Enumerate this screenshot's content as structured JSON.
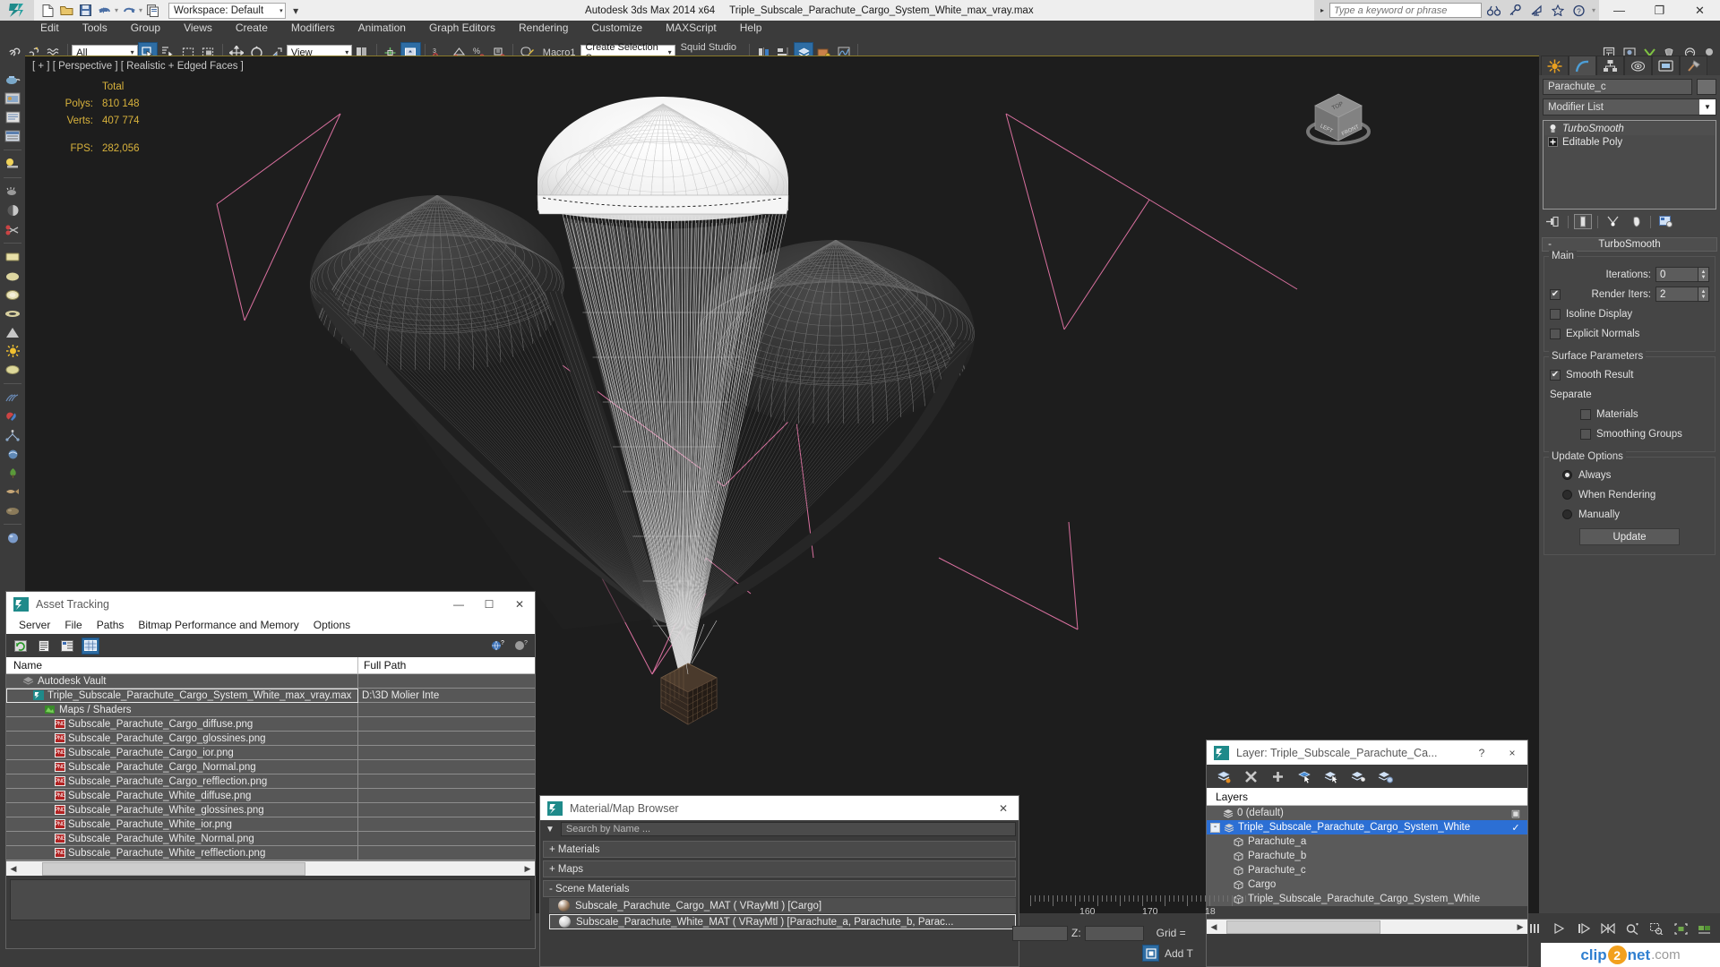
{
  "titlebar": {
    "app_title": "Autodesk 3ds Max  2014 x64",
    "file_name": "Triple_Subscale_Parachute_Cargo_System_White_max_vray.max",
    "workspace_label": "Workspace: Default",
    "search_placeholder": "Type a keyword or phrase",
    "quick_access": [
      "new-icon",
      "open-icon",
      "save-icon",
      "undo-icon",
      "redo-icon",
      "set-project-icon"
    ],
    "right_icons": [
      "binoculars-icon",
      "key-icon",
      "satellite-icon",
      "star-icon",
      "help-icon"
    ],
    "window_buttons": [
      "minimize-icon",
      "restore-icon",
      "close-icon"
    ]
  },
  "menubar": {
    "items": [
      "Edit",
      "Tools",
      "Group",
      "Views",
      "Create",
      "Modifiers",
      "Animation",
      "Graph Editors",
      "Rendering",
      "Customize",
      "MAXScript",
      "Help"
    ]
  },
  "toolbar": {
    "selection_filter": "All",
    "reference_coord": "View",
    "macro_label": "Macro1",
    "named_selection_set": "Create Selection Se",
    "squid_label": "Squid Studio v"
  },
  "viewport": {
    "label": "[ + ] [ Perspective ] [ Realistic + Edged Faces ]",
    "stats": {
      "header": "Total",
      "polys_label": "Polys:",
      "polys_value": "810 148",
      "verts_label": "Verts:",
      "verts_value": "407 774",
      "fps_label": "FPS:",
      "fps_value": "282,056"
    },
    "viewcube_faces": [
      "TOP",
      "LEFT",
      "FRONT"
    ]
  },
  "asset_tracking": {
    "title": "Asset Tracking",
    "menu": [
      "Server",
      "File",
      "Paths",
      "Bitmap Performance and Memory",
      "Options"
    ],
    "toolbar_icons": [
      "refresh-icon",
      "list-icon",
      "tree-icon",
      "grid-icon",
      "help-globe-icon",
      "help-icon"
    ],
    "columns": [
      "Name",
      "Full Path"
    ],
    "rows": [
      {
        "indent": 0,
        "icon": "vault-icon",
        "name": "Autodesk Vault",
        "path": ""
      },
      {
        "indent": 1,
        "icon": "max-icon",
        "name": "Triple_Subscale_Parachute_Cargo_System_White_max_vray.max",
        "path": "D:\\3D Molier Inte",
        "selected": true
      },
      {
        "indent": 2,
        "icon": "maps-icon",
        "name": "Maps / Shaders",
        "path": ""
      },
      {
        "indent": 3,
        "icon": "png-icon",
        "name": "Subscale_Parachute_Cargo_diffuse.png",
        "path": ""
      },
      {
        "indent": 3,
        "icon": "png-icon",
        "name": "Subscale_Parachute_Cargo_glossines.png",
        "path": ""
      },
      {
        "indent": 3,
        "icon": "png-icon",
        "name": "Subscale_Parachute_Cargo_ior.png",
        "path": ""
      },
      {
        "indent": 3,
        "icon": "png-icon",
        "name": "Subscale_Parachute_Cargo_Normal.png",
        "path": ""
      },
      {
        "indent": 3,
        "icon": "png-icon",
        "name": "Subscale_Parachute_Cargo_refflection.png",
        "path": ""
      },
      {
        "indent": 3,
        "icon": "png-icon",
        "name": "Subscale_Parachute_White_diffuse.png",
        "path": ""
      },
      {
        "indent": 3,
        "icon": "png-icon",
        "name": "Subscale_Parachute_White_glossines.png",
        "path": ""
      },
      {
        "indent": 3,
        "icon": "png-icon",
        "name": "Subscale_Parachute_White_ior.png",
        "path": ""
      },
      {
        "indent": 3,
        "icon": "png-icon",
        "name": "Subscale_Parachute_White_Normal.png",
        "path": ""
      },
      {
        "indent": 3,
        "icon": "png-icon",
        "name": "Subscale_Parachute_White_refflection.png",
        "path": ""
      }
    ]
  },
  "material_browser": {
    "title": "Material/Map Browser",
    "search_value": "Search by Name ...",
    "groups": [
      {
        "sign": "+",
        "label": "Materials"
      },
      {
        "sign": "+",
        "label": "Maps"
      },
      {
        "sign": "-",
        "label": "Scene Materials"
      }
    ],
    "scene_materials": [
      {
        "label": "Subscale_Parachute_Cargo_MAT  ( VRayMtl )  [Cargo]",
        "color": "#9a7b5e",
        "selected": false
      },
      {
        "label": "Subscale_Parachute_White_MAT  ( VRayMtl )  [Parachute_a, Parachute_b, Parac...",
        "color": "#cfcfcf",
        "selected": true
      }
    ]
  },
  "layer_dialog": {
    "title": "Layer: Triple_Subscale_Parachute_Ca...",
    "help_glyph": "?",
    "close_glyph": "×",
    "toolbar_icons": [
      "new-layer-icon",
      "delete-layer-icon",
      "add-layer-icon",
      "select-objects-icon",
      "highlight-icon",
      "select-layer-icon",
      "layer-props-icon"
    ],
    "column_header": "Layers",
    "rows": [
      {
        "indent": 0,
        "icon": "layer-icon",
        "label": "0 (default)",
        "selected": false,
        "box": true
      },
      {
        "indent": 0,
        "icon": "layer-icon",
        "label": "Triple_Subscale_Parachute_Cargo_System_White",
        "selected": true,
        "check": true,
        "expander": "-"
      },
      {
        "indent": 1,
        "icon": "object-icon",
        "label": "Parachute_a",
        "selected": false
      },
      {
        "indent": 1,
        "icon": "object-icon",
        "label": "Parachute_b",
        "selected": false
      },
      {
        "indent": 1,
        "icon": "object-icon",
        "label": "Parachute_c",
        "selected": false
      },
      {
        "indent": 1,
        "icon": "object-icon",
        "label": "Cargo",
        "selected": false
      },
      {
        "indent": 1,
        "icon": "object-icon",
        "label": "Triple_Subscale_Parachute_Cargo_System_White",
        "selected": false
      }
    ]
  },
  "command_panel": {
    "tabs": [
      "create-tab",
      "modify-tab",
      "hierarchy-tab",
      "motion-tab",
      "display-tab",
      "utilities-tab"
    ],
    "active_tab_index": 1,
    "object_name": "Parachute_c",
    "modifier_list_label": "Modifier List",
    "stack": [
      {
        "label": "TurboSmooth",
        "active": true,
        "icon": "light-bulb-icon"
      },
      {
        "label": "Editable Poly",
        "active": false,
        "icon": "plus-box-icon"
      }
    ],
    "stack_buttons": [
      "pin-stack-icon",
      "show-end-result-icon",
      "make-unique-icon",
      "remove-modifier-icon",
      "configure-sets-icon"
    ],
    "rollout": {
      "expander": "-",
      "title": "TurboSmooth",
      "groups": [
        {
          "title": "Main",
          "rows": [
            {
              "type": "spinner",
              "label": "Iterations:",
              "value": "0"
            },
            {
              "type": "spinner_check",
              "label": "Render Iters:",
              "value": "2",
              "checked": true
            },
            {
              "type": "check",
              "label": "Isoline Display",
              "checked": false
            },
            {
              "type": "check",
              "label": "Explicit Normals",
              "checked": false
            }
          ]
        },
        {
          "title": "Surface Parameters",
          "rows": [
            {
              "type": "check",
              "label": "Smooth Result",
              "checked": true
            },
            {
              "type": "text",
              "label": "Separate"
            },
            {
              "type": "check_indent",
              "label": "Materials",
              "checked": false
            },
            {
              "type": "check_indent",
              "label": "Smoothing Groups",
              "checked": false
            }
          ]
        },
        {
          "title": "Update Options",
          "rows": [
            {
              "type": "radio",
              "label": "Always",
              "checked": true
            },
            {
              "type": "radio",
              "label": "When Rendering",
              "checked": false
            },
            {
              "type": "radio",
              "label": "Manually",
              "checked": false
            },
            {
              "type": "button",
              "label": "Update"
            }
          ]
        }
      ]
    }
  },
  "status_bar": {
    "timeline_ticks": [
      "160",
      "170",
      "18"
    ],
    "z_label": "Z:",
    "grid_label": "Grid =",
    "add_time_label": "Add T",
    "playback_icons": [
      "key-mode-icon",
      "play-icon",
      "next-frame-icon",
      "end-frame-icon",
      "zoom-icon",
      "zoom-region-icon",
      "zoom-extents-icon",
      "zoom-extents-all-icon"
    ]
  },
  "watermark": {
    "part1": "clip",
    "part2": "2",
    "part3": "net",
    "part4": ".com"
  },
  "colors": {
    "accent_blue": "#2c6fd4",
    "panel_bg": "#3b3b3b",
    "viewport_bg": "#1d1d1d",
    "stat_yellow": "#d8b23c",
    "helper_pink": "#d9709f"
  }
}
